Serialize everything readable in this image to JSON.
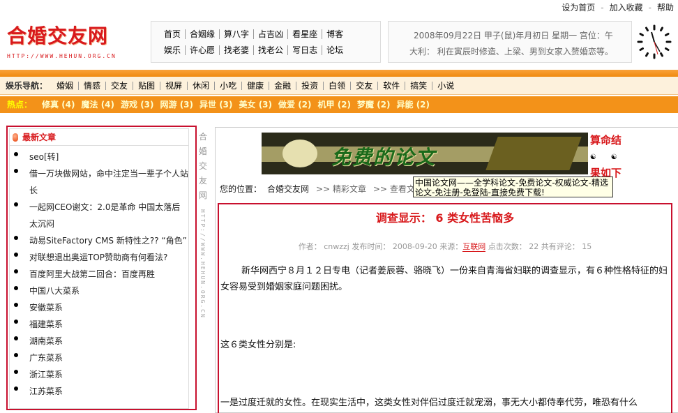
{
  "toplinks": [
    "设为首页",
    "加入收藏",
    "帮助"
  ],
  "logo": {
    "name": "合婚交友网",
    "url": "HTTP://WWW.HEHUN.ORG.CN"
  },
  "mainnav": {
    "row1": [
      "首页",
      "合姻缘",
      "算八字",
      "占吉凶",
      "看星座",
      "博客"
    ],
    "row2": [
      "娱乐",
      "许心愿",
      "找老婆",
      "找老公",
      "写日志",
      "论坛"
    ]
  },
  "datebox": {
    "line1": "2008年09月22日  甲子(鼠)年月初日  星期一  宫位：午",
    "line2": "大利：  利在寅辰时修造、上梁、男到女家入赘婚恋等。"
  },
  "entbar": {
    "label": "娱乐导航：",
    "items": [
      "婚姻",
      "情感",
      "交友",
      "贴图",
      "视屏",
      "休闲",
      "小吃",
      "健康",
      "金融",
      "投资",
      "白领",
      "交友",
      "软件",
      "搞笑",
      "小说"
    ]
  },
  "hotbar": {
    "label": "热点：",
    "items": [
      "修真 (4)",
      "魔法 (4)",
      "游戏 (3)",
      "网游 (3)",
      "异世 (3)",
      "美女 (3)",
      "做爱 (2)",
      "机甲 (2)",
      "梦魔 (2)",
      "异能 (2)"
    ]
  },
  "sidebar": {
    "title": "最新文章",
    "articles": [
      "seo[转]",
      "借一万块做网站，命中注定当一辈子个人站长",
      "一起网CEO谢文：2.0是革命 中国太落后太沉闷",
      "动易SiteFactory CMS 新特性之?? “角色”",
      "对联想退出奥运TOP赞助商有何看法?",
      "百度阿里大战第二回合：百度再胜",
      "中国八大菜系",
      "安徽菜系",
      "福建菜系",
      "湖南菜系",
      "广东菜系",
      "浙江菜系",
      "江苏菜系"
    ]
  },
  "vertical": {
    "brand": "合婚交友网",
    "url": "HTTP://WWW.HEHUN.ORG.CN"
  },
  "banner": {
    "text": "免费的论文"
  },
  "side_ad": {
    "line1": "算命结",
    "line2": "果如下"
  },
  "breadcrumb": {
    "label": "您的位置：",
    "items": [
      "合婚交友网",
      ">> 精彩文章",
      ">> 查看文章"
    ]
  },
  "popup": {
    "text": "中国论文网——全学科论文-免费论文-权威论文-精选论文-免注册-免登陆-直接免费下载!"
  },
  "article": {
    "title": "调查显示： 6 类女性苦恼多",
    "meta_prefix": "作者： cnwzzj 发布时间： 2008-09-20 来源：",
    "source": "互联网",
    "meta_suffix": " 点击次数： 22 共有评论： 15",
    "p1": "新华网西宁８月１２日专电（记者姜辰蓉、骆晓飞）一份来自青海省妇联的调查显示，有６种性格特征的妇女容易受到婚姻家庭问题困扰。",
    "p2": "这６类女性分别是:",
    "p3": "一是过度迁就的女性。在现实生活中，这类女性对伴侣过度迁就宠溺，事无大小都侍奉代劳，唯恐有什么"
  }
}
